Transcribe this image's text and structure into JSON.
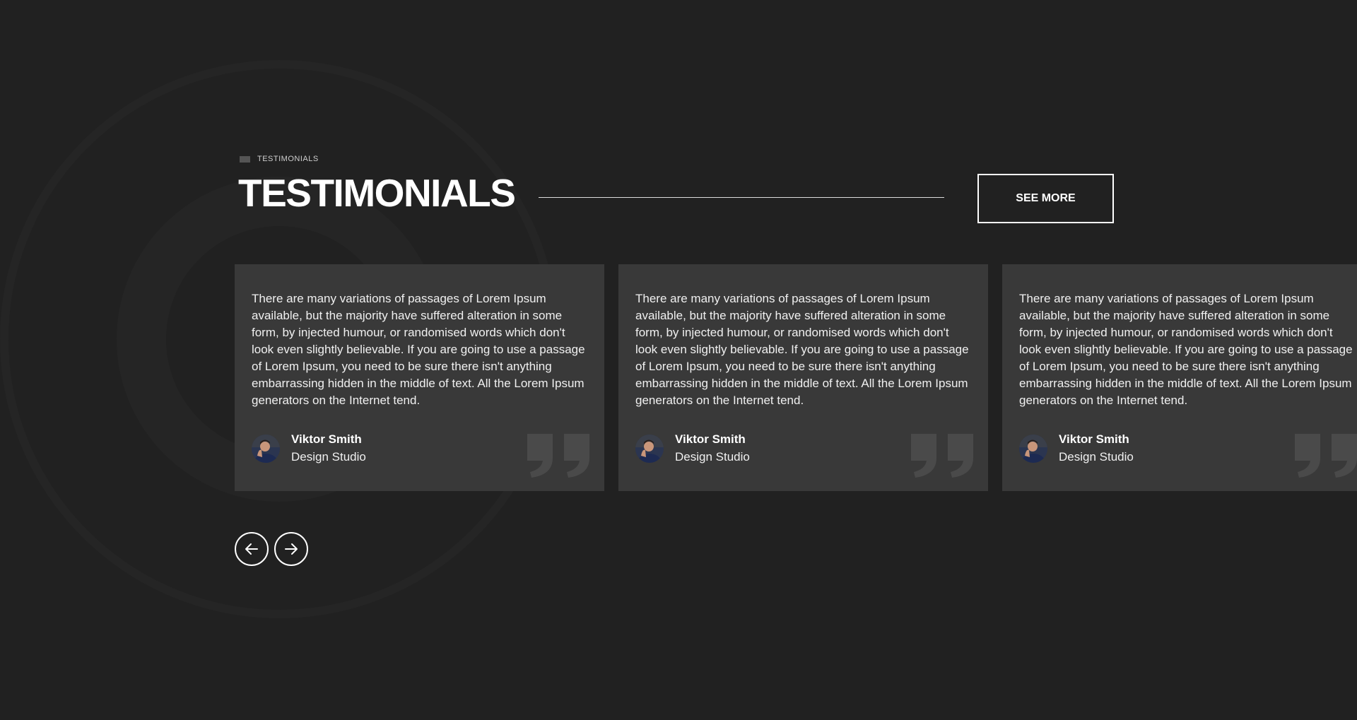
{
  "section": {
    "eyebrow": "TESTIMONIALS",
    "title": "TESTIMONIALS",
    "see_more_label": "SEE MORE"
  },
  "testimonials": [
    {
      "text": "There are many variations of passages of Lorem Ipsum available, but the majority have suffered alteration in some form, by injected humour, or randomised words which don't look even slightly believable. If you are going to use a passage of Lorem Ipsum, you need to be sure there isn't anything embarrassing hidden in the middle of text. All the Lorem Ipsum generators on the Internet tend.",
      "author_name": "Viktor Smith",
      "author_role": "Design Studio"
    },
    {
      "text": "There are many variations of passages of Lorem Ipsum available, but the majority have suffered alteration in some form, by injected humour, or randomised words which don't look even slightly believable. If you are going to use a passage of Lorem Ipsum, you need to be sure there isn't anything embarrassing hidden in the middle of text. All the Lorem Ipsum generators on the Internet tend.",
      "author_name": "Viktor Smith",
      "author_role": "Design Studio"
    },
    {
      "text": "There are many variations of passages of Lorem Ipsum available, but the majority have suffered alteration in some form, by injected humour, or randomised words which don't look even slightly believable. If you are going to use a passage of Lorem Ipsum, you need to be sure there isn't anything embarrassing hidden in the middle of text. All the Lorem Ipsum generators on the Internet tend.",
      "author_name": "Viktor Smith",
      "author_role": "Design Studio"
    }
  ],
  "navigation": {
    "prev_icon": "arrow-left-icon",
    "next_icon": "arrow-right-icon"
  },
  "colors": {
    "background": "#212121",
    "card": "#393939",
    "text": "#ffffff",
    "quote_mark": "#4a4a4a"
  }
}
